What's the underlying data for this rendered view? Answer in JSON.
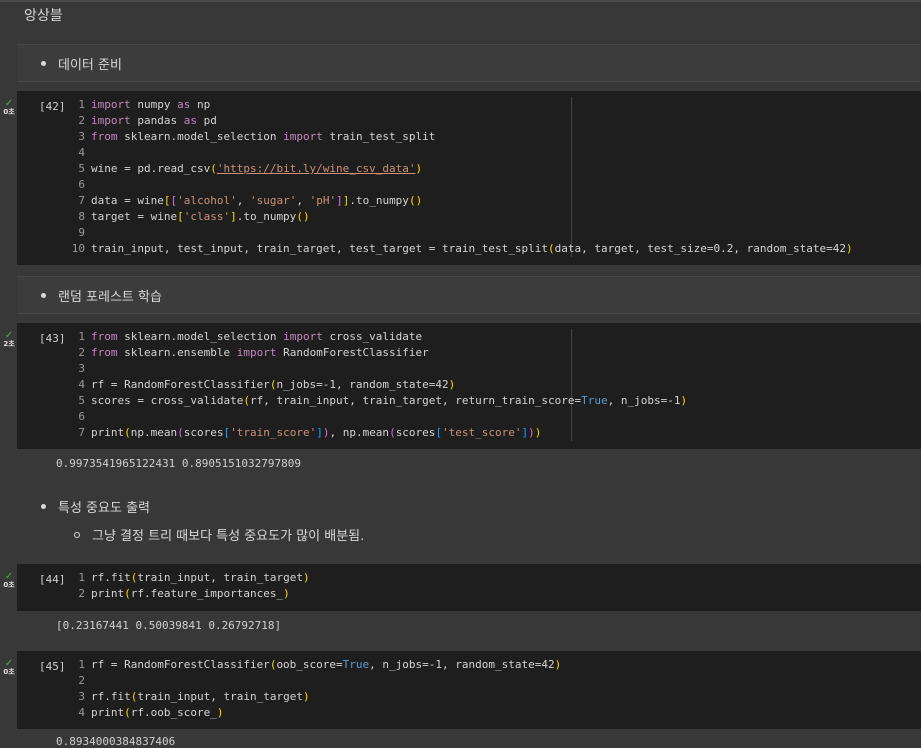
{
  "notebook": {
    "section_title": "앙상블"
  },
  "text_cells": [
    {
      "bullet": "데이터 준비"
    },
    {
      "bullet": "랜덤 포레스트 학습"
    },
    {
      "bullet": "특성 중요도 출력",
      "sub_bullet": "그냥 결정 트리 때보다 특성 중요도가 많이 배분됨."
    }
  ],
  "code_cells": [
    {
      "exec_count": "[42]",
      "run_time": "0초",
      "line_numbers": [
        "1",
        "2",
        "3",
        "4",
        "5",
        "6",
        "7",
        "8",
        "9",
        "10"
      ]
    },
    {
      "exec_count": "[43]",
      "run_time": "2초",
      "line_numbers": [
        "1",
        "2",
        "3",
        "4",
        "5",
        "6",
        "7"
      ],
      "output": "0.9973541965122431 0.8905151032797809"
    },
    {
      "exec_count": "[44]",
      "run_time": "0초",
      "line_numbers": [
        "1",
        "2"
      ],
      "output": "[0.23167441 0.50039841 0.26792718]"
    },
    {
      "exec_count": "[45]",
      "run_time": "0초",
      "line_numbers": [
        "1",
        "2",
        "3",
        "4"
      ],
      "output": "0.8934000384837406"
    }
  ],
  "code": {
    "c42": {
      "l1": [
        "import",
        " numpy ",
        "as",
        " np"
      ],
      "l2": [
        "import",
        " pandas ",
        "as",
        " pd"
      ],
      "l3": [
        "from",
        " sklearn.model_selection ",
        "import",
        " train_test_split"
      ],
      "l5": [
        "wine = pd.read_csv(",
        "(",
        "'https://bit.ly/wine_csv_data'",
        ")"
      ],
      "l7": [
        "data = wine",
        "[",
        "[",
        "'alcohol'",
        ", ",
        "'sugar'",
        ", ",
        "'pH'",
        "]",
        "]",
        ".to_numpy",
        "(",
        ")"
      ],
      "l8": [
        "target = wine",
        "[",
        "'class'",
        "]",
        ".to_numpy",
        "(",
        ")"
      ],
      "l10": [
        "train_input, test_input, train_target, test_target = train_test_split",
        "(",
        "data, target, test_size=0.2, random_state=42",
        ")"
      ]
    },
    "c43": {
      "l1": [
        "from",
        " sklearn.model_selection ",
        "import",
        " cross_validate"
      ],
      "l2": [
        "from",
        " sklearn.ensemble ",
        "import",
        " RandomForestClassifier"
      ],
      "l4": [
        "rf = RandomForestClassifier",
        "(",
        "n_jobs=-1, random_state=42",
        ")"
      ],
      "l5": [
        "scores = cross_validate",
        "(",
        "rf, train_input, train_target, return_train_score=",
        "True",
        ", n_jobs=-1",
        ")"
      ],
      "l7": [
        "print",
        "(",
        "np.mean",
        "(",
        "scores",
        "[",
        "'train_score'",
        "]",
        ")",
        ", np.mean",
        "(",
        "scores",
        "[",
        "'test_score'",
        "]",
        ")",
        ")"
      ]
    },
    "c44": {
      "l1": [
        "rf.fit",
        "(",
        "train_input, train_target",
        ")"
      ],
      "l2": [
        "print",
        "(",
        "rf.feature_importances_",
        ")"
      ]
    },
    "c45": {
      "l1": [
        "rf = RandomForestClassifier",
        "(",
        "oob_score=",
        "True",
        ", n_jobs=-1, random_state=42",
        ")"
      ],
      "l3": [
        "rf.fit",
        "(",
        "train_input, train_target",
        ")"
      ],
      "l4": [
        "print",
        "(",
        "rf.oob_score_",
        ")"
      ]
    }
  },
  "icons": {
    "run_status": "check-icon"
  },
  "colors": {
    "background": "#383838",
    "code_bg": "#1e1e1e",
    "keyword": "#c586c0",
    "string": "#ce9178",
    "bool": "#569cd6",
    "check": "#4caf50"
  }
}
